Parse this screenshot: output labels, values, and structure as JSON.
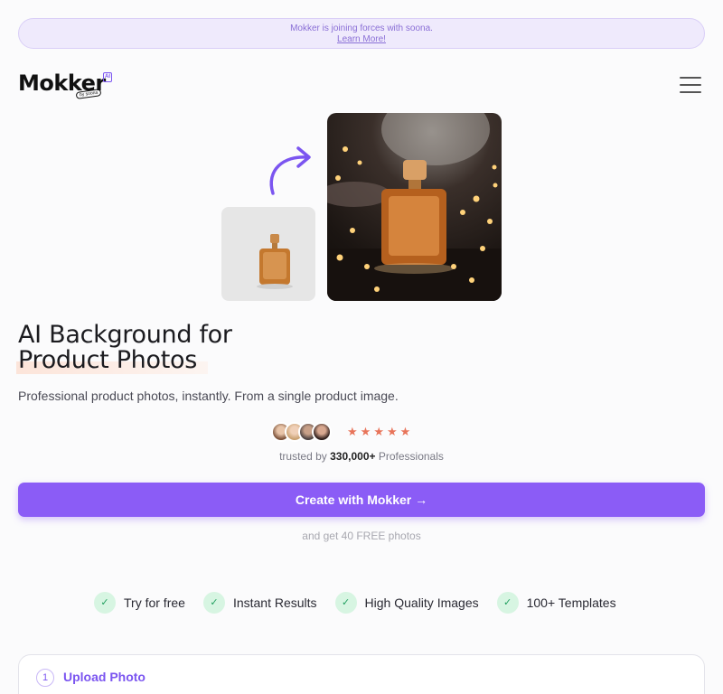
{
  "banner": {
    "text": "Mokker is joining forces with soona.",
    "link": "Learn More!"
  },
  "header": {
    "logo_text": "Mokker",
    "logo_badge": "AI",
    "logo_sub": "by soona",
    "menu_icon": "hamburger-icon"
  },
  "hero": {
    "title_line1": "AI Background for",
    "title_line2": "Product Photos",
    "subtitle": "Professional product photos, instantly. From a single product image."
  },
  "social_proof": {
    "stars": 5,
    "trusted_prefix": "trusted by",
    "count": "330,000+",
    "trusted_suffix": "Professionals"
  },
  "cta": {
    "label": "Create with Mokker →",
    "note": "and get 40 FREE photos"
  },
  "features": [
    {
      "label": "Try for free"
    },
    {
      "label": "Instant Results"
    },
    {
      "label": "High Quality Images"
    },
    {
      "label": "100+ Templates"
    }
  ],
  "upload": {
    "step": "1",
    "label": "Upload Photo"
  },
  "colors": {
    "accent": "#8b5cf6",
    "star": "#e8745a",
    "check_bg": "#d7f5e2",
    "check": "#22a060"
  }
}
